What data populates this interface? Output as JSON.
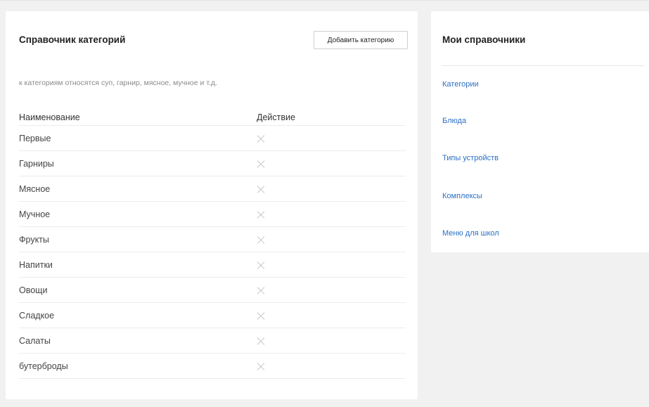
{
  "main": {
    "title": "Справочник категорий",
    "add_button_label": "Добавить категорию",
    "hint": "к категориям относятся суп, гарнир, мясное, мучное и т.д.",
    "table": {
      "columns": [
        "Наименование",
        "Действие"
      ],
      "rows": [
        {
          "name": "Первые",
          "action_icon": "close-icon"
        },
        {
          "name": "Гарниры",
          "action_icon": "close-icon"
        },
        {
          "name": "Мясное",
          "action_icon": "close-icon"
        },
        {
          "name": "Мучное",
          "action_icon": "close-icon"
        },
        {
          "name": "Фрукты",
          "action_icon": "close-icon"
        },
        {
          "name": "Напитки",
          "action_icon": "close-icon"
        },
        {
          "name": "Овощи",
          "action_icon": "close-icon"
        },
        {
          "name": "Сладкое",
          "action_icon": "close-icon"
        },
        {
          "name": "Салаты",
          "action_icon": "close-icon"
        },
        {
          "name": "бутерброды",
          "action_icon": "close-icon"
        }
      ]
    }
  },
  "sidebar": {
    "title": "Мои справочники",
    "links": [
      {
        "label": "Категории"
      },
      {
        "label": "Блюда"
      },
      {
        "label": "Типы устройств"
      },
      {
        "label": "Комплексы"
      },
      {
        "label": "Меню для школ"
      }
    ]
  },
  "colors": {
    "background": "#f1f1f1",
    "panel": "#ffffff",
    "link": "#2b6fc4",
    "hint_text": "#8a8a8a"
  }
}
